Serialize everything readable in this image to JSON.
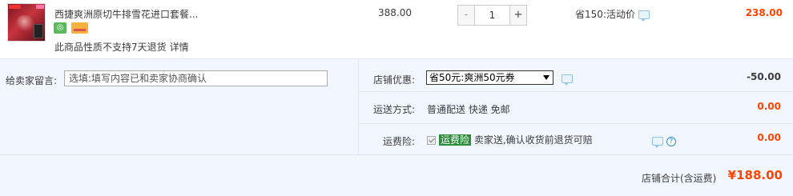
{
  "item": {
    "title": "西捷爽洲原切牛排雪花进口套餐...",
    "no_return_text": "此商品性质不支持7天退货",
    "detail_link": "详情",
    "unit_price": "388.00",
    "quantity": "1",
    "minus_label": "-",
    "plus_label": "+",
    "promo_text": "省150:活动价",
    "total": "238.00"
  },
  "order": {
    "message_label": "给卖家留言:",
    "message_placeholder": "选填:填写内容已和卖家协商确认",
    "coupon_label": "店铺优惠:",
    "coupon_selected": "省50元:爽洲50元券",
    "coupon_value": "-50.00",
    "shipping_label": "运送方式:",
    "shipping_method": "普通配送 快递 免邮",
    "shipping_value": "0.00",
    "insurance_label": "运费险:",
    "insurance_tag": "运费险",
    "insurance_text": "卖家送,确认收货前退货可赔",
    "insurance_checked": true,
    "insurance_value": "0.00",
    "qmark": "?"
  },
  "summary": {
    "total_label": "店铺合计(含运费)",
    "total_amount": "¥188.00"
  },
  "colors": {
    "accent_red": "#ff4400",
    "panel_bg": "#f2f7ff",
    "insurance_green": "#2c8b3b"
  }
}
